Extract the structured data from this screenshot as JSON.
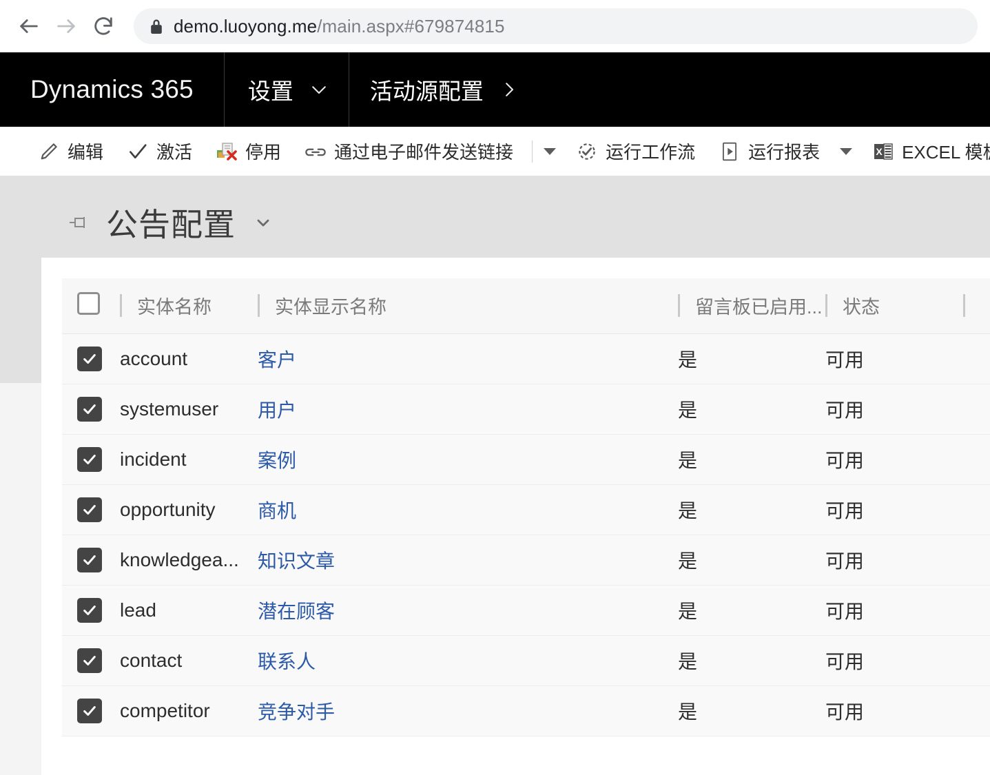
{
  "browser": {
    "back_icon": "back-arrow-icon",
    "forward_icon": "forward-arrow-icon",
    "reload_icon": "reload-icon",
    "lock_icon": "lock-icon",
    "url_domain": "demo.luoyong.me",
    "url_path": "/main.aspx#679874815",
    "url_full": "demo.luoyong.me/main.aspx#679874815"
  },
  "topnav": {
    "brand": "Dynamics 365",
    "area_label": "设置",
    "area_chevron": "chevron-down-icon",
    "entity_label": "活动源配置",
    "entity_chevron": "chevron-right-icon"
  },
  "ribbon": {
    "commands": [
      {
        "label": "编辑",
        "icon": "pencil-icon"
      },
      {
        "label": "激活",
        "icon": "checkmark-icon"
      },
      {
        "label": "停用",
        "icon": "deactivate-icon"
      },
      {
        "label": "通过电子邮件发送链接",
        "icon": "link-icon"
      },
      {
        "label": "运行工作流",
        "icon": "workflow-icon"
      },
      {
        "label": "运行报表",
        "icon": "report-icon"
      },
      {
        "label": "EXCEL 模板",
        "icon": "excel-icon"
      }
    ],
    "overflow_icon": "excel-icon-partial"
  },
  "page": {
    "pin_icon": "pin-icon",
    "title": "公告配置",
    "title_chevron": "chevron-down-icon"
  },
  "grid": {
    "select_all_checkbox": "unchecked",
    "columns": [
      {
        "key": "name",
        "label": "实体名称"
      },
      {
        "key": "display",
        "label": "实体显示名称"
      },
      {
        "key": "board",
        "label": "留言板已启用..."
      },
      {
        "key": "state",
        "label": "状态"
      }
    ],
    "rows": [
      {
        "checked": true,
        "name": "account",
        "display": "客户",
        "board": "是",
        "state": "可用"
      },
      {
        "checked": true,
        "name": "systemuser",
        "display": "用户",
        "board": "是",
        "state": "可用"
      },
      {
        "checked": true,
        "name": "incident",
        "display": "案例",
        "board": "是",
        "state": "可用"
      },
      {
        "checked": true,
        "name": "opportunity",
        "display": "商机",
        "board": "是",
        "state": "可用"
      },
      {
        "checked": true,
        "name": "knowledgea...",
        "display": "知识文章",
        "board": "是",
        "state": "可用"
      },
      {
        "checked": true,
        "name": "lead",
        "display": "潜在顾客",
        "board": "是",
        "state": "可用"
      },
      {
        "checked": true,
        "name": "contact",
        "display": "联系人",
        "board": "是",
        "state": "可用"
      },
      {
        "checked": true,
        "name": "competitor",
        "display": "竞争对手",
        "board": "是",
        "state": "可用"
      }
    ]
  },
  "colors": {
    "nav_background": "#000000",
    "page_background": "#e1e1e1",
    "row_background": "#f9f9f9",
    "link": "#2c5aa8",
    "checkbox_checked": "#444444",
    "header_text": "#7a7a7a"
  }
}
